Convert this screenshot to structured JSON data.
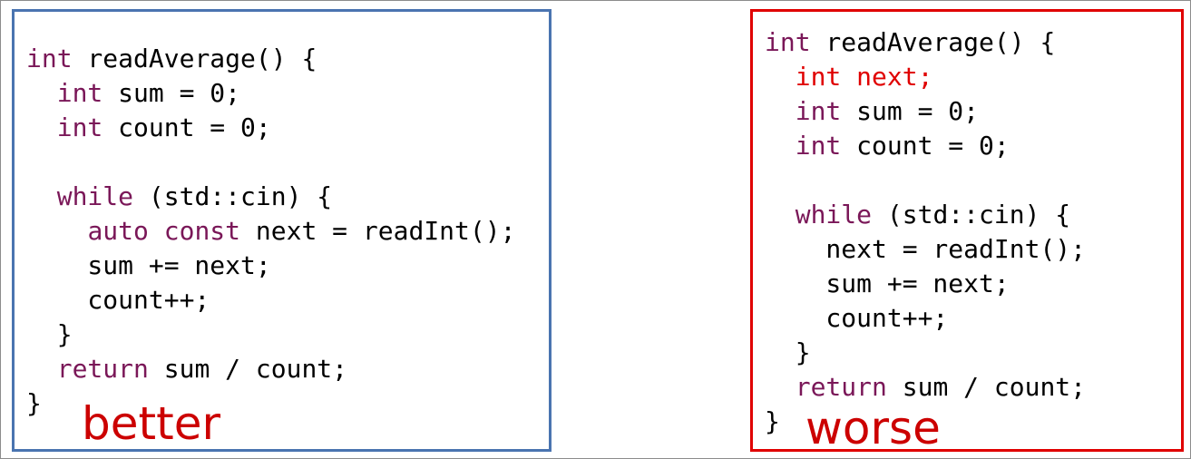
{
  "colors": {
    "better_border": "#4a74b0",
    "worse_border": "#e00000",
    "keyword": "#7a1758",
    "highlight": "#e00000",
    "verdict_text": "#cc0000"
  },
  "better": {
    "label": "better",
    "lines": [
      [
        {
          "t": "int",
          "c": "kw"
        },
        {
          "t": " readAverage() {"
        }
      ],
      [
        {
          "t": "  "
        },
        {
          "t": "int",
          "c": "kw"
        },
        {
          "t": " sum = 0;"
        }
      ],
      [
        {
          "t": "  "
        },
        {
          "t": "int",
          "c": "kw"
        },
        {
          "t": " count = 0;"
        }
      ],
      [],
      [
        {
          "t": "  "
        },
        {
          "t": "while",
          "c": "kw"
        },
        {
          "t": " (std::cin) {"
        }
      ],
      [
        {
          "t": "    "
        },
        {
          "t": "auto",
          "c": "kw"
        },
        {
          "t": " "
        },
        {
          "t": "const",
          "c": "kw"
        },
        {
          "t": " next = readInt();"
        }
      ],
      [
        {
          "t": "    sum += next;"
        }
      ],
      [
        {
          "t": "    count++;"
        }
      ],
      [
        {
          "t": "  }"
        }
      ],
      [
        {
          "t": "  "
        },
        {
          "t": "return",
          "c": "kw"
        },
        {
          "t": " sum / count;"
        }
      ],
      [
        {
          "t": "}"
        }
      ]
    ]
  },
  "worse": {
    "label": "worse",
    "lines": [
      [
        {
          "t": "int",
          "c": "kw"
        },
        {
          "t": " readAverage() {"
        }
      ],
      [
        {
          "t": "  "
        },
        {
          "t": "int next;",
          "c": "hl"
        }
      ],
      [
        {
          "t": "  "
        },
        {
          "t": "int",
          "c": "kw"
        },
        {
          "t": " sum = 0;"
        }
      ],
      [
        {
          "t": "  "
        },
        {
          "t": "int",
          "c": "kw"
        },
        {
          "t": " count = 0;"
        }
      ],
      [],
      [
        {
          "t": "  "
        },
        {
          "t": "while",
          "c": "kw"
        },
        {
          "t": " (std::cin) {"
        }
      ],
      [
        {
          "t": "    next = readInt();"
        }
      ],
      [
        {
          "t": "    sum += next;"
        }
      ],
      [
        {
          "t": "    count++;"
        }
      ],
      [
        {
          "t": "  }"
        }
      ],
      [
        {
          "t": "  "
        },
        {
          "t": "return",
          "c": "kw"
        },
        {
          "t": " sum / count;"
        }
      ],
      [
        {
          "t": "}"
        }
      ]
    ]
  }
}
